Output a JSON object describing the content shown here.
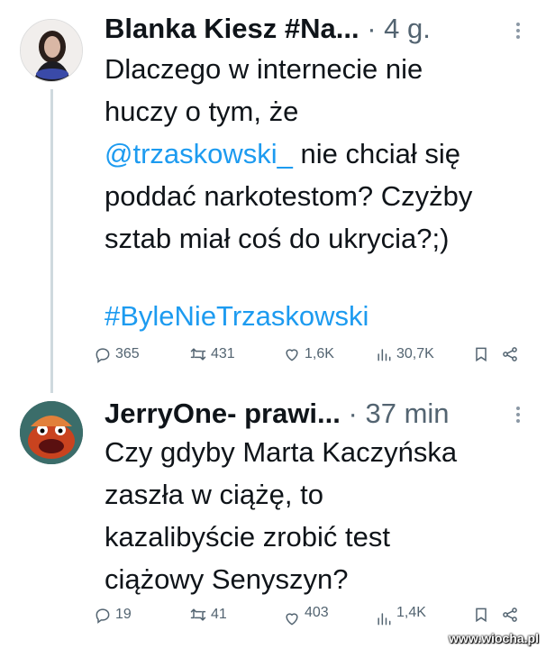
{
  "tweet1": {
    "author_name": "Blanka Kiesz #Na...",
    "separator": "·",
    "time": "4 g.",
    "text_lines": [
      "Dlaczego w internecie nie",
      "huczy o tym, że"
    ],
    "mention": "@trzaskowski_",
    "text_after_mention": " nie chciał się",
    "text_lines_2": [
      "poddać narkotestom? Czyżby",
      "sztab miał coś do ukrycia?;)"
    ],
    "hashtag": "#ByleNieTrzaskowski",
    "stats": {
      "replies": "365",
      "reposts": "431",
      "likes": "1,6K",
      "views": "30,7K"
    }
  },
  "tweet2": {
    "author_name": "JerryOne- prawi...",
    "separator": "·",
    "time": "37 min",
    "text_lines": [
      "Czy gdyby Marta Kaczyńska",
      "zaszła w ciążę, to",
      "kazalibyście zrobić test",
      "ciążowy Senyszyn?"
    ],
    "stats": {
      "replies": "19",
      "reposts": "41",
      "likes": "403",
      "views": "1,4K"
    }
  },
  "watermark": "www.wiocha.pl",
  "colors": {
    "link": "#1d9bf0",
    "text": "#0f1419",
    "muted": "#536471",
    "thread_line": "#cfd9de"
  }
}
